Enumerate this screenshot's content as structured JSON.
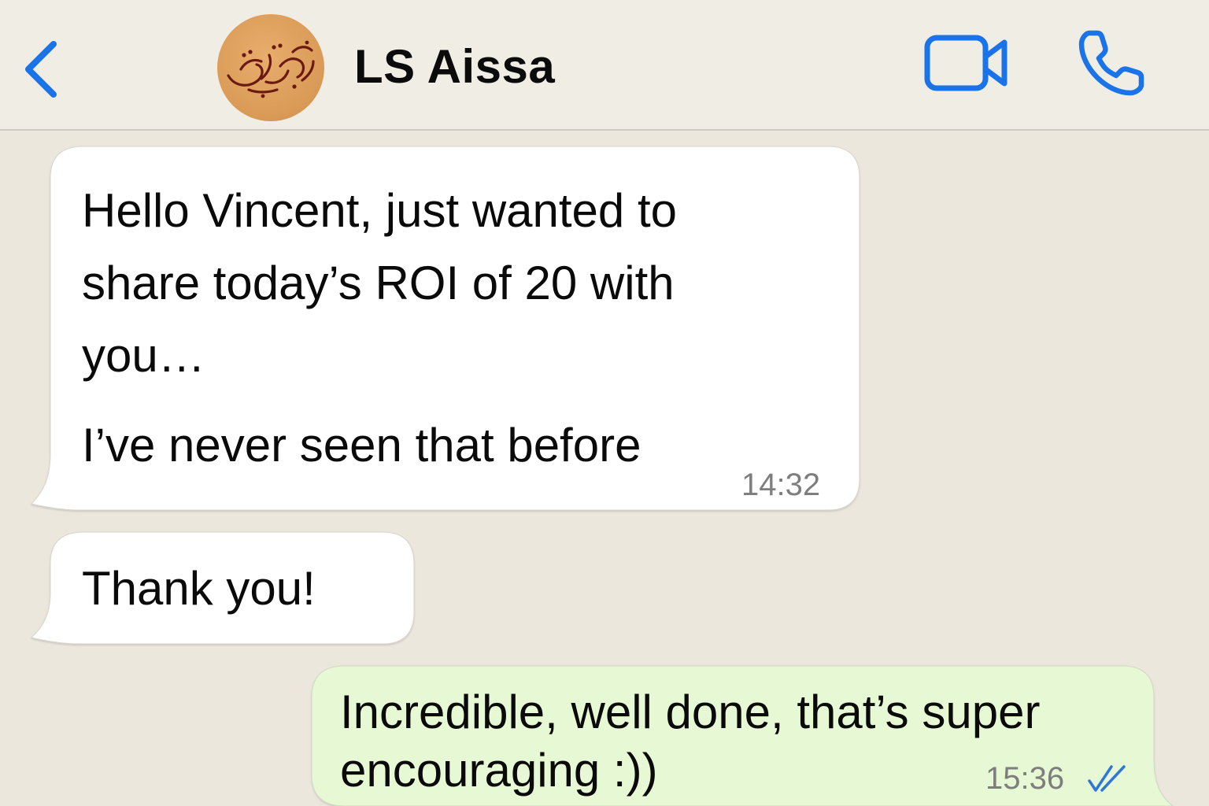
{
  "header": {
    "back_icon": "chevron-left-icon",
    "contact_name": "LS Aissa",
    "avatar_icon": "calligraphy-avatar",
    "video_icon": "video-camera-icon",
    "call_icon": "phone-icon",
    "accent_color": "#1a73e8"
  },
  "messages": [
    {
      "direction": "incoming",
      "lines": [
        "Hello Vincent, just wanted to",
        "share today’s ROI of 20 with",
        "you…"
      ],
      "line2": "I’ve never seen that before",
      "time": "14:32"
    },
    {
      "direction": "incoming",
      "text": "Thank you!"
    },
    {
      "direction": "outgoing",
      "lines": [
        "Incredible, well done, that’s super",
        "encouraging :))"
      ],
      "time": "15:36",
      "status_icon": "double-check-icon"
    }
  ],
  "colors": {
    "background": "#ece7dd",
    "header_background": "#f0ede5",
    "incoming_bubble": "#ffffff",
    "outgoing_bubble": "#e7f8d4",
    "read_check": "#2f78d8"
  }
}
